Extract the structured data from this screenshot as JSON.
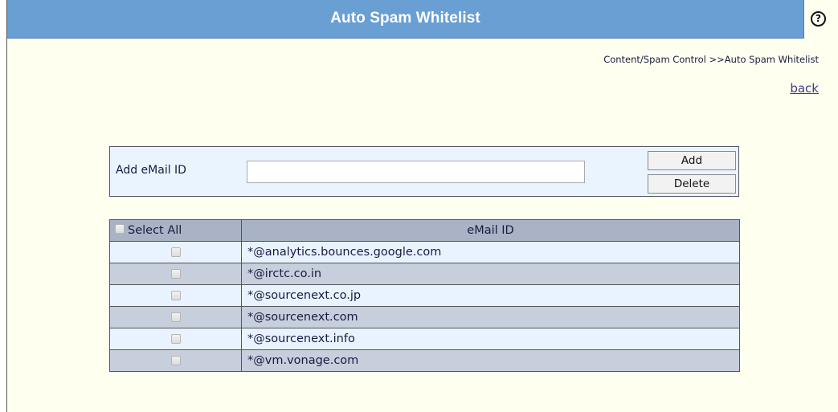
{
  "header": {
    "title": "Auto Spam Whitelist",
    "help_label": "?"
  },
  "breadcrumb": "Content/Spam Control >>Auto Spam Whitelist",
  "back_link": "back",
  "add_form": {
    "label": "Add eMail ID",
    "input_value": "",
    "add_button": "Add",
    "delete_button": "Delete"
  },
  "table": {
    "select_all_label": "Select All",
    "email_header": "eMail ID",
    "rows": [
      {
        "email": "*@analytics.bounces.google.com",
        "checked": false
      },
      {
        "email": "*@irctc.co.in",
        "checked": false
      },
      {
        "email": "*@sourcenext.co.jp",
        "checked": false
      },
      {
        "email": "*@sourcenext.com",
        "checked": false
      },
      {
        "email": "*@sourcenext.info",
        "checked": false
      },
      {
        "email": "*@vm.vonage.com",
        "checked": false
      }
    ]
  },
  "colors": {
    "title_bar": "#6a9fd4",
    "page_background": "#fffff0",
    "row_light": "#e9f3ff",
    "row_dark": "#c7cfdd",
    "table_header": "#a9b3c5"
  }
}
